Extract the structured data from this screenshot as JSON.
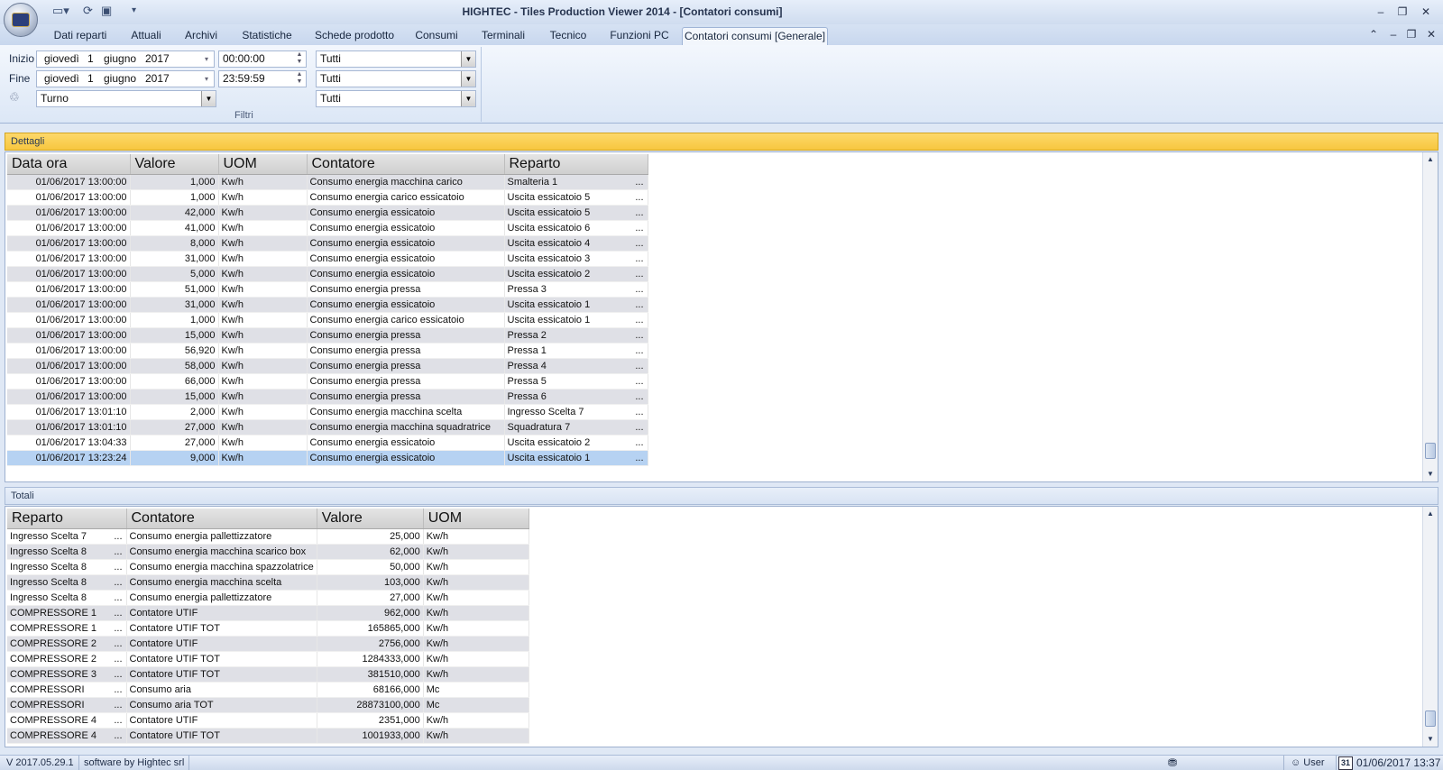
{
  "window": {
    "title": "HIGHTEC - Tiles Production Viewer 2014 - [Contatori consumi]",
    "minimize_icon": "minimize-icon",
    "restore_icon": "restore-icon",
    "close_icon": "close-icon"
  },
  "tabs": [
    {
      "label": "Dati reparti"
    },
    {
      "label": "Attuali"
    },
    {
      "label": "Archivi"
    },
    {
      "label": "Statistiche"
    },
    {
      "label": "Schede prodotto"
    },
    {
      "label": "Consumi"
    },
    {
      "label": "Terminali"
    },
    {
      "label": "Tecnico"
    },
    {
      "label": "Funzioni PC"
    },
    {
      "label": "Contatori consumi [Generale]",
      "active": true
    }
  ],
  "filters": {
    "start_label": "Inizio",
    "end_label": "Fine",
    "start_date": {
      "weekday": "giovedì",
      "day": "1",
      "month": "giugno",
      "year": "2017"
    },
    "start_time": "00:00:00",
    "end_date": {
      "weekday": "giovedì",
      "day": "1",
      "month": "giugno",
      "year": "2017"
    },
    "end_time": "23:59:59",
    "shift": "Turno",
    "filter1": "Tutti",
    "filter2": "Tutti",
    "filter3": "Tutti",
    "group_label": "Filtri"
  },
  "dettagli": {
    "header": "Dettagli",
    "columns": [
      "Data ora",
      "Valore",
      "UOM",
      "Contatore",
      "Reparto"
    ],
    "rows": [
      [
        "01/06/2017 13:00:00",
        "1,000",
        "Kw/h",
        "Consumo energia macchina carico",
        "Smalteria 1"
      ],
      [
        "01/06/2017 13:00:00",
        "1,000",
        "Kw/h",
        "Consumo energia carico essicatoio",
        "Uscita essicatoio  5"
      ],
      [
        "01/06/2017 13:00:00",
        "42,000",
        "Kw/h",
        "Consumo energia essicatoio",
        "Uscita essicatoio  5"
      ],
      [
        "01/06/2017 13:00:00",
        "41,000",
        "Kw/h",
        "Consumo energia essicatoio",
        "Uscita essicatoio  6"
      ],
      [
        "01/06/2017 13:00:00",
        "8,000",
        "Kw/h",
        "Consumo energia essicatoio",
        "Uscita essicatoio  4"
      ],
      [
        "01/06/2017 13:00:00",
        "31,000",
        "Kw/h",
        "Consumo energia essicatoio",
        "Uscita essicatoio  3"
      ],
      [
        "01/06/2017 13:00:00",
        "5,000",
        "Kw/h",
        "Consumo energia essicatoio",
        "Uscita essicatoio  2"
      ],
      [
        "01/06/2017 13:00:00",
        "51,000",
        "Kw/h",
        "Consumo energia pressa",
        "Pressa 3"
      ],
      [
        "01/06/2017 13:00:00",
        "31,000",
        "Kw/h",
        "Consumo energia essicatoio",
        "Uscita essicatoio  1"
      ],
      [
        "01/06/2017 13:00:00",
        "1,000",
        "Kw/h",
        "Consumo energia carico essicatoio",
        "Uscita essicatoio  1"
      ],
      [
        "01/06/2017 13:00:00",
        "15,000",
        "Kw/h",
        "Consumo energia pressa",
        "Pressa 2"
      ],
      [
        "01/06/2017 13:00:00",
        "56,920",
        "Kw/h",
        "Consumo energia pressa",
        "Pressa 1"
      ],
      [
        "01/06/2017 13:00:00",
        "58,000",
        "Kw/h",
        "Consumo energia pressa",
        "Pressa 4"
      ],
      [
        "01/06/2017 13:00:00",
        "66,000",
        "Kw/h",
        "Consumo energia pressa",
        "Pressa 5"
      ],
      [
        "01/06/2017 13:00:00",
        "15,000",
        "Kw/h",
        "Consumo energia pressa",
        "Pressa 6"
      ],
      [
        "01/06/2017 13:01:10",
        "2,000",
        "Kw/h",
        "Consumo energia macchina scelta",
        "Ingresso Scelta 7"
      ],
      [
        "01/06/2017 13:01:10",
        "27,000",
        "Kw/h",
        "Consumo energia macchina squadratrice",
        "Squadratura 7"
      ],
      [
        "01/06/2017 13:04:33",
        "27,000",
        "Kw/h",
        "Consumo energia essicatoio",
        "Uscita essicatoio  2"
      ],
      [
        "01/06/2017 13:23:24",
        "9,000",
        "Kw/h",
        "Consumo energia essicatoio",
        "Uscita essicatoio  1"
      ]
    ],
    "ellipsis": "..."
  },
  "totali": {
    "header": "Totali",
    "columns": [
      "Reparto",
      "Contatore",
      "Valore",
      "UOM"
    ],
    "rows": [
      [
        "Ingresso Scelta 7",
        "Consumo energia pallettizzatore",
        "25,000",
        "Kw/h"
      ],
      [
        "Ingresso Scelta 8",
        "Consumo energia macchina scarico box",
        "62,000",
        "Kw/h"
      ],
      [
        "Ingresso Scelta 8",
        "Consumo energia macchina spazzolatrice",
        "50,000",
        "Kw/h"
      ],
      [
        "Ingresso Scelta 8",
        "Consumo energia macchina scelta",
        "103,000",
        "Kw/h"
      ],
      [
        "Ingresso Scelta 8",
        "Consumo energia pallettizzatore",
        "27,000",
        "Kw/h"
      ],
      [
        "COMPRESSORE 1",
        "Contatore UTIF",
        "962,000",
        "Kw/h"
      ],
      [
        "COMPRESSORE 1",
        "Contatore UTIF TOT",
        "165865,000",
        "Kw/h"
      ],
      [
        "COMPRESSORE 2",
        "Contatore UTIF",
        "2756,000",
        "Kw/h"
      ],
      [
        "COMPRESSORE 2",
        "Contatore UTIF TOT",
        "1284333,000",
        "Kw/h"
      ],
      [
        "COMPRESSORE 3",
        "Contatore UTIF TOT",
        "381510,000",
        "Kw/h"
      ],
      [
        "COMPRESSORI",
        "Consumo aria",
        "68166,000",
        "Mc"
      ],
      [
        "COMPRESSORI",
        "Consumo aria TOT",
        "28873100,000",
        "Mc"
      ],
      [
        "COMPRESSORE 4",
        "Contatore UTIF",
        "2351,000",
        "Kw/h"
      ],
      [
        "COMPRESSORE 4",
        "Contatore UTIF TOT",
        "1001933,000",
        "Kw/h"
      ]
    ]
  },
  "status": {
    "version": "V 2017.05.29.1",
    "credit": "software by Hightec srl",
    "user": "User",
    "calendar_day": "31",
    "datetime": "01/06/2017 13:37"
  }
}
